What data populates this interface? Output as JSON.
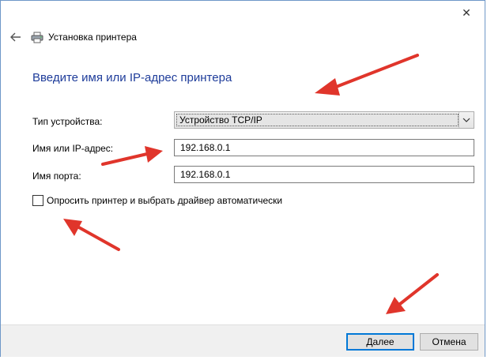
{
  "window": {
    "title": "Установка принтера",
    "close_label": "✕"
  },
  "heading": "Введите имя или IP-адрес принтера",
  "form": {
    "device_type_label": "Тип устройства:",
    "device_type_value": "Устройство TCP/IP",
    "host_label": "Имя или IP-адрес:",
    "host_value": "192.168.0.1",
    "port_label": "Имя порта:",
    "port_value": "192.168.0.1",
    "autodetect_label": "Опросить принтер и выбрать драйвер автоматически",
    "autodetect_checked": false
  },
  "buttons": {
    "next_label": "Далее",
    "cancel_label": "Отмена"
  },
  "icons": {
    "back": "back-arrow-icon",
    "printer": "printer-icon",
    "close": "close-icon",
    "dropdown": "chevron-down-icon"
  },
  "colors": {
    "heading": "#1e3c9a",
    "annotation_arrow": "#e0352b",
    "primary_button_border": "#0078d7"
  }
}
